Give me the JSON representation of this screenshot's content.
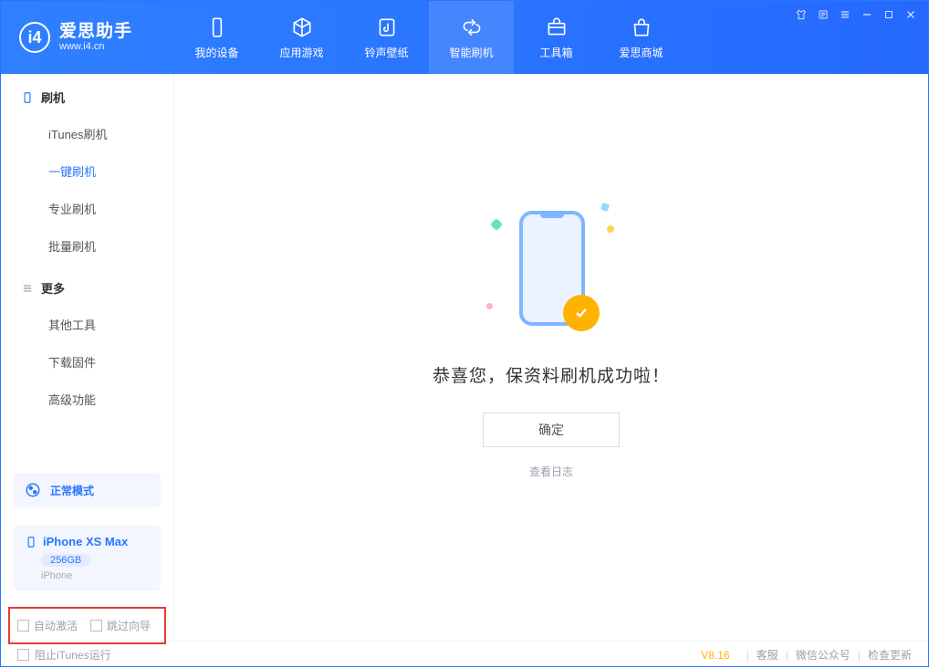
{
  "app": {
    "title": "爱思助手",
    "subtitle": "www.i4.cn"
  },
  "nav": {
    "items": [
      {
        "label": "我的设备"
      },
      {
        "label": "应用游戏"
      },
      {
        "label": "铃声壁纸"
      },
      {
        "label": "智能刷机"
      },
      {
        "label": "工具箱"
      },
      {
        "label": "爱思商城"
      }
    ]
  },
  "sidebar": {
    "group1": {
      "title": "刷机",
      "items": [
        {
          "label": "iTunes刷机"
        },
        {
          "label": "一键刷机"
        },
        {
          "label": "专业刷机"
        },
        {
          "label": "批量刷机"
        }
      ]
    },
    "group2": {
      "title": "更多",
      "items": [
        {
          "label": "其他工具"
        },
        {
          "label": "下载固件"
        },
        {
          "label": "高级功能"
        }
      ]
    },
    "mode": {
      "label": "正常模式"
    },
    "device": {
      "name": "iPhone XS Max",
      "capacity": "256GB",
      "type": "iPhone"
    },
    "options": {
      "auto_activate": "自动激活",
      "skip_guide": "跳过向导"
    }
  },
  "content": {
    "success_msg": "恭喜您，保资料刷机成功啦！",
    "ok_btn": "确定",
    "log_link": "查看日志"
  },
  "footer": {
    "block_itunes": "阻止iTunes运行",
    "version": "V8.16",
    "links": {
      "service": "客服",
      "wechat": "微信公众号",
      "update": "检查更新"
    }
  }
}
